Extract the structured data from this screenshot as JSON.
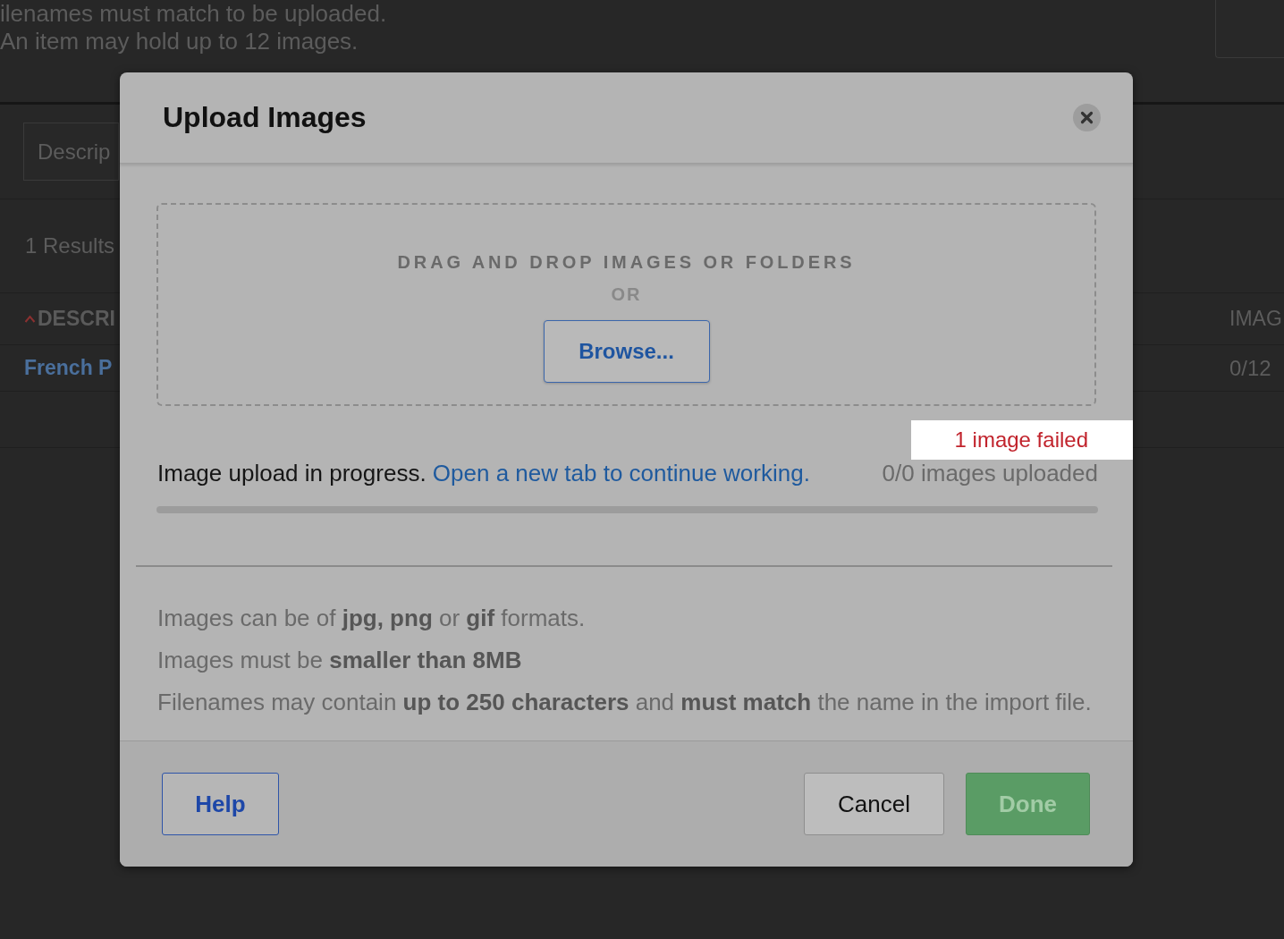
{
  "background": {
    "notes": [
      "ilenames must match to be uploaded.",
      "An item may hold up to 12 images."
    ],
    "search": {
      "placeholder": "Descrip"
    },
    "results_count": "1 Results",
    "table": {
      "columns": [
        {
          "label": "DESCRI",
          "sorted": true
        },
        {
          "label": "IMAG",
          "sorted": false
        }
      ],
      "rows": [
        [
          "French P",
          "0/12"
        ]
      ]
    }
  },
  "modal": {
    "title": "Upload Images",
    "dropzone": {
      "prompt": "DRAG AND DROP IMAGES OR FOLDERS",
      "separator": "OR",
      "browse_button": "Browse..."
    },
    "progress": {
      "error": "1 image failed",
      "message": "Image upload in progress.",
      "link": "Open a new tab to continue working.",
      "count": "0/0 images uploaded",
      "level": 0
    },
    "rules": [
      "Images can be of **jpg, png** or **gif** formats.",
      "Images must be **smaller than 8MB**",
      "Filenames may contain **up to 250 characters** and **must match** the name in the import file."
    ],
    "buttons": [
      {
        "label": "Help",
        "kind": "help",
        "disabled": false
      },
      {
        "label": "Cancel",
        "kind": "secondary",
        "disabled": false
      },
      {
        "label": "Done",
        "kind": "primary",
        "disabled": true
      }
    ]
  }
}
